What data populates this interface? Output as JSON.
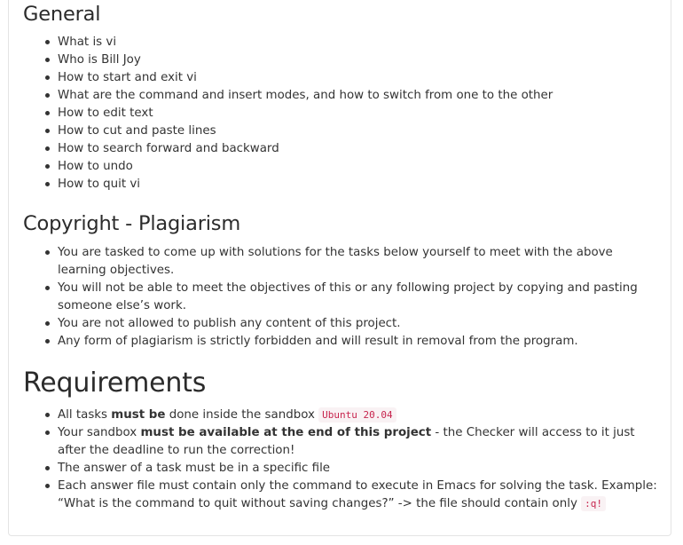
{
  "general": {
    "heading": "General",
    "items": [
      "What is vi",
      "Who is Bill Joy",
      "How to start and exit vi",
      "What are the command and insert modes, and how to switch from one to the other",
      "How to edit text",
      "How to cut and paste lines",
      "How to search forward and backward",
      "How to undo",
      "How to quit vi"
    ]
  },
  "copyright": {
    "heading": "Copyright - Plagiarism",
    "items": [
      "You are tasked to come up with solutions for the tasks below yourself to meet with the above learning objectives.",
      "You will not be able to meet the objectives of this or any following project by copying and pasting someone else’s work.",
      "You are not allowed to publish any content of this project.",
      "Any form of plagiarism is strictly forbidden and will result in removal from the program."
    ]
  },
  "requirements": {
    "heading": "Requirements",
    "item1": {
      "pre": "All tasks ",
      "bold": "must be",
      "post": " done inside the sandbox ",
      "code": "Ubuntu 20.04"
    },
    "item2": {
      "pre": "Your sandbox ",
      "bold": "must be available at the end of this project",
      "post": " - the Checker will access to it just after the deadline to run the correction!"
    },
    "item3": "The answer of a task must be in a specific file",
    "item4": {
      "text": "Each answer file must contain only the command to execute in Emacs for solving the task. Example: “What is the command to quit without saving changes?” -> the file should contain only ",
      "code": ":q!"
    }
  }
}
